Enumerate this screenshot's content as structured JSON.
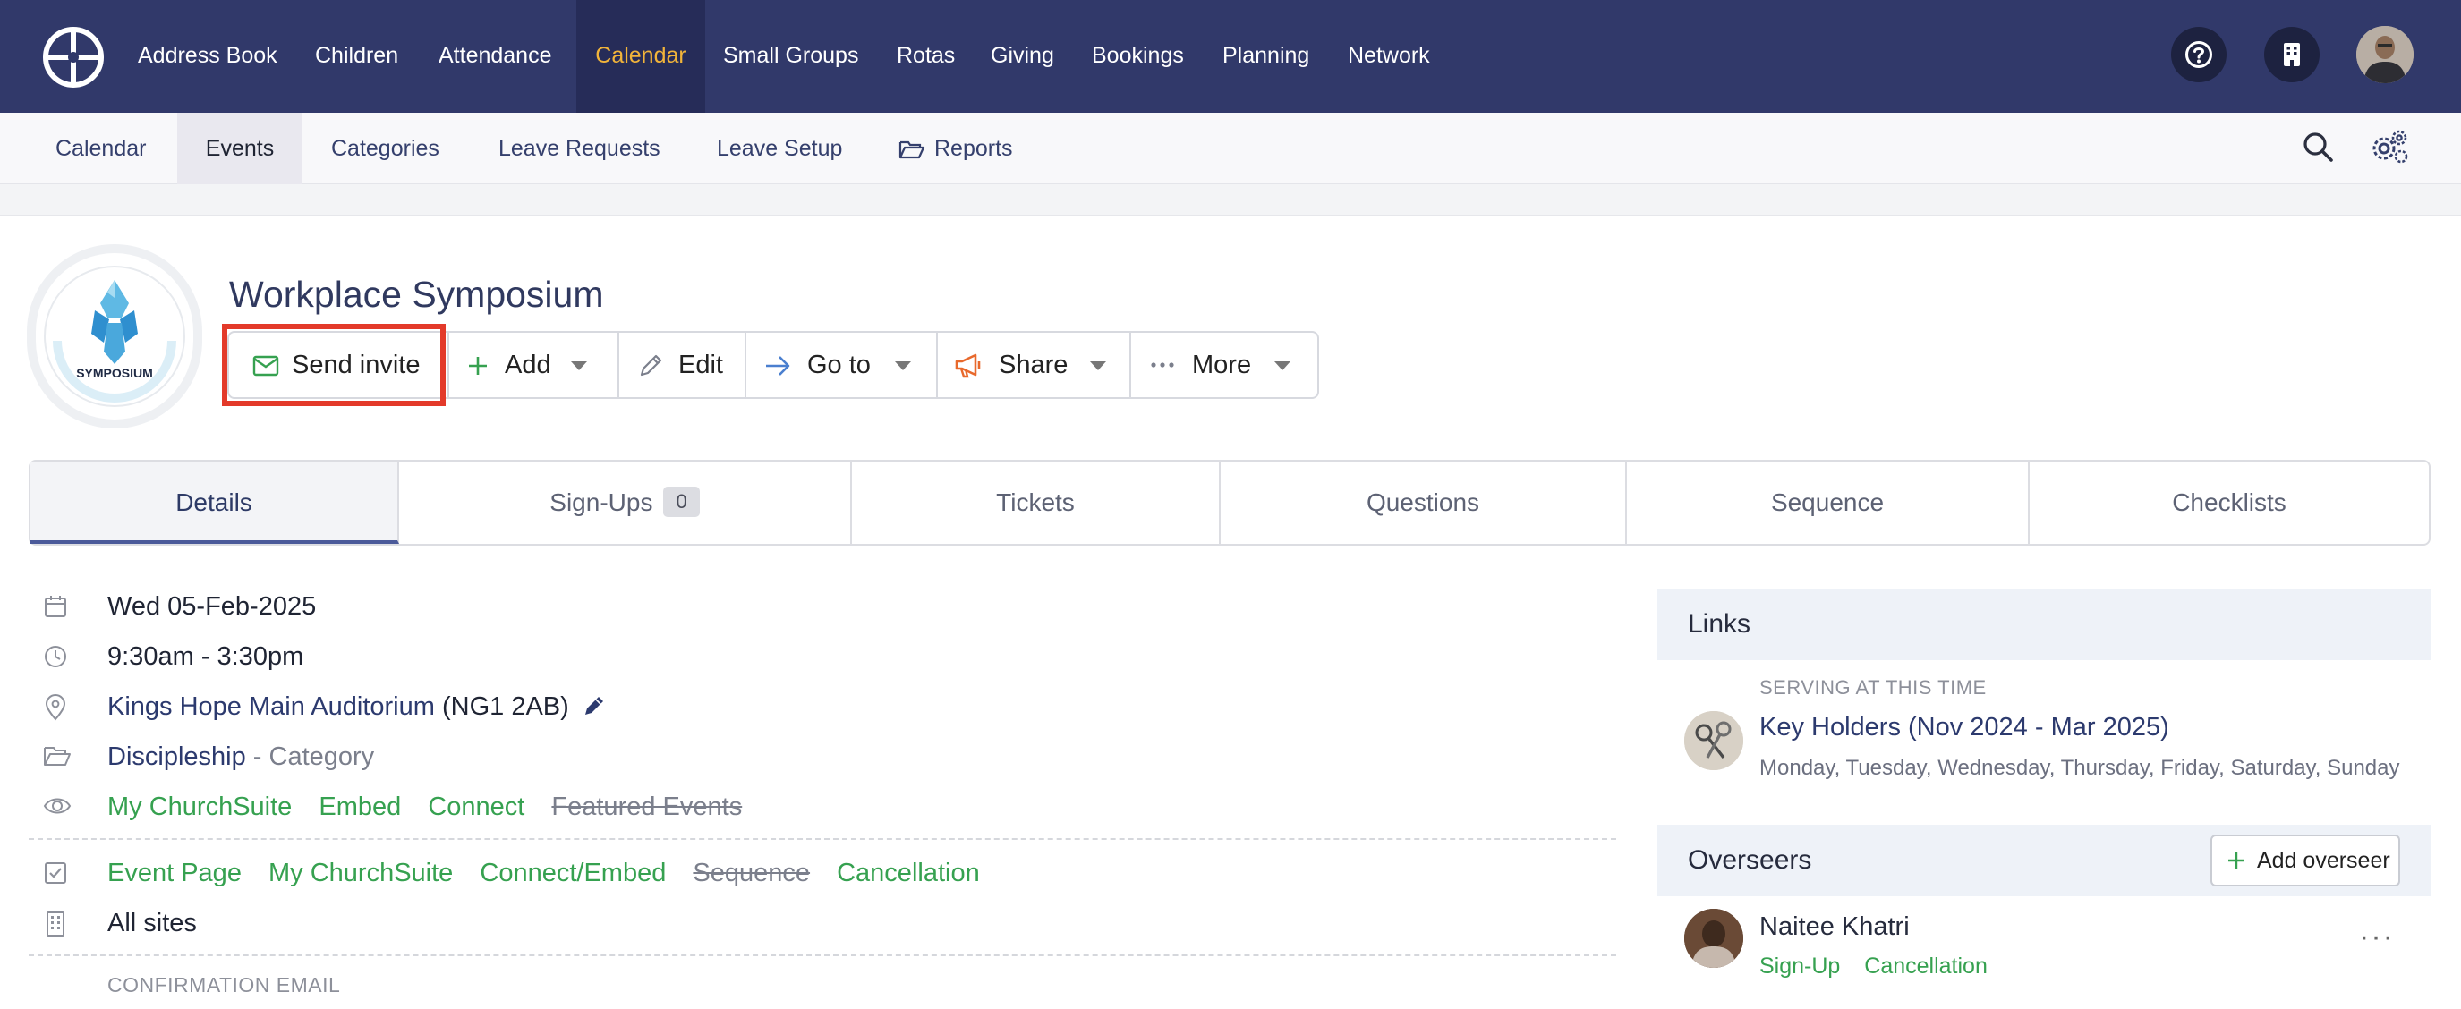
{
  "topnav": {
    "items": [
      "Address Book",
      "Children",
      "Attendance",
      "Calendar",
      "Small Groups",
      "Rotas",
      "Giving",
      "Bookings",
      "Planning",
      "Network"
    ],
    "active": "Calendar",
    "accent_color": "#f1b43a",
    "background_color": "#31396a"
  },
  "subnav": {
    "items": [
      "Calendar",
      "Events",
      "Categories",
      "Leave Requests",
      "Leave Setup",
      "Reports"
    ],
    "active": "Events"
  },
  "event": {
    "title": "Workplace Symposium",
    "logo_text": "SYMPOSIUM"
  },
  "actions": {
    "send_invite": "Send invite",
    "add": "Add",
    "edit": "Edit",
    "goto": "Go to",
    "share": "Share",
    "more": "More"
  },
  "tabs": {
    "details": "Details",
    "signups": "Sign-Ups",
    "signups_count": "0",
    "tickets": "Tickets",
    "questions": "Questions",
    "sequence": "Sequence",
    "checklists": "Checklists",
    "active": "Details"
  },
  "details": {
    "date": "Wed 05-Feb-2025",
    "time": "9:30am - 3:30pm",
    "location": "Kings Hope Main Auditorium",
    "postcode": "(NG1 2AB)",
    "category": "Discipleship",
    "category_suffix": "- Category",
    "visibility": {
      "my_churchsuite": "My ChurchSuite",
      "embed": "Embed",
      "connect": "Connect",
      "featured": "Featured Events"
    },
    "options": {
      "event_page": "Event Page",
      "my_churchsuite": "My ChurchSuite",
      "connect_embed": "Connect/Embed",
      "sequence": "Sequence",
      "cancellation": "Cancellation"
    },
    "sites": "All sites",
    "confirmation_email_label": "CONFIRMATION EMAIL"
  },
  "links_panel": {
    "title": "Links",
    "serving_label": "SERVING AT THIS TIME",
    "serving_title": "Key Holders (Nov 2024 - Mar 2025)",
    "serving_days": "Monday, Tuesday, Wednesday, Thursday, Friday, Saturday, Sunday"
  },
  "overseers_panel": {
    "title": "Overseers",
    "add_button": "Add overseer",
    "name": "Naitee Khatri",
    "signup_link": "Sign-Up",
    "cancellation_link": "Cancellation",
    "more": "···"
  },
  "colors": {
    "green_link": "#36a150",
    "highlight_border": "#e33a2a",
    "panel_header": "#eef2f8"
  }
}
